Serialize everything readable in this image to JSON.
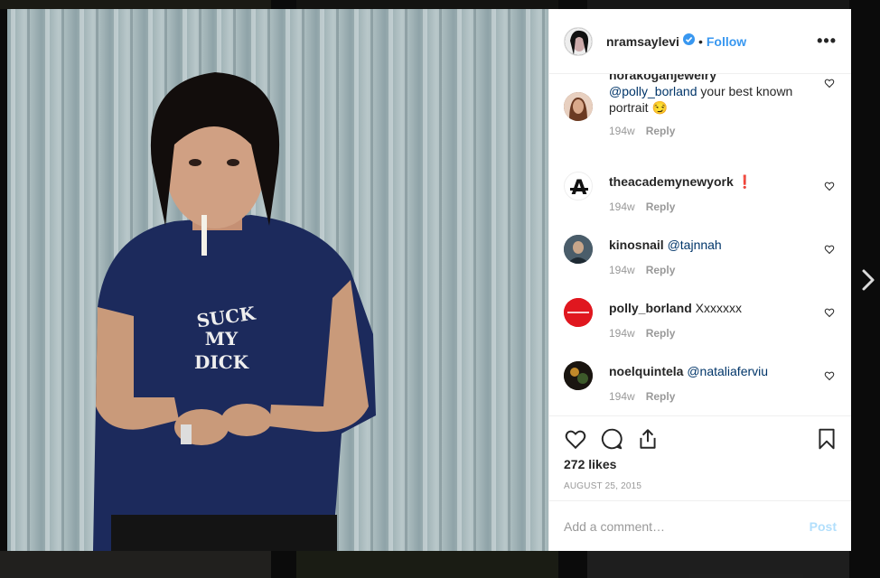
{
  "header": {
    "username": "nramsaylevi",
    "separator": "•",
    "follow_label": "Follow",
    "more_label": "•••"
  },
  "photo": {
    "shirt_text_line1": "SUCK",
    "shirt_text_line2": "MY",
    "shirt_text_line3": "DICK"
  },
  "comments": [
    {
      "user": "norakoganjewelry",
      "mention": "@polly_borland",
      "text": " your best known portrait 😏",
      "age": "194w",
      "reply": "Reply"
    },
    {
      "user": "theacademynewyork",
      "mention": "",
      "text": " ❗",
      "age": "194w",
      "reply": "Reply"
    },
    {
      "user": "kinosnail",
      "mention": " @tajnnah",
      "text": "",
      "age": "194w",
      "reply": "Reply"
    },
    {
      "user": "polly_borland",
      "mention": "",
      "text": " Xxxxxxx",
      "age": "194w",
      "reply": "Reply"
    },
    {
      "user": "noelquintela",
      "mention": " @nataliaferviu",
      "text": "",
      "age": "194w",
      "reply": "Reply"
    }
  ],
  "post": {
    "likes": "272 likes",
    "date": "AUGUST 25, 2015",
    "comment_placeholder": "Add a comment…",
    "post_label": "Post"
  },
  "icons": {
    "like": "heart-icon",
    "comment": "comment-icon",
    "share": "share-icon",
    "save": "bookmark-icon",
    "next": "chevron-right-icon",
    "verified": "verified-badge-icon"
  },
  "colors": {
    "link_blue": "#3897f0",
    "mention_blue": "#003569",
    "muted": "#999999",
    "post_disabled": "#b2dffc"
  }
}
